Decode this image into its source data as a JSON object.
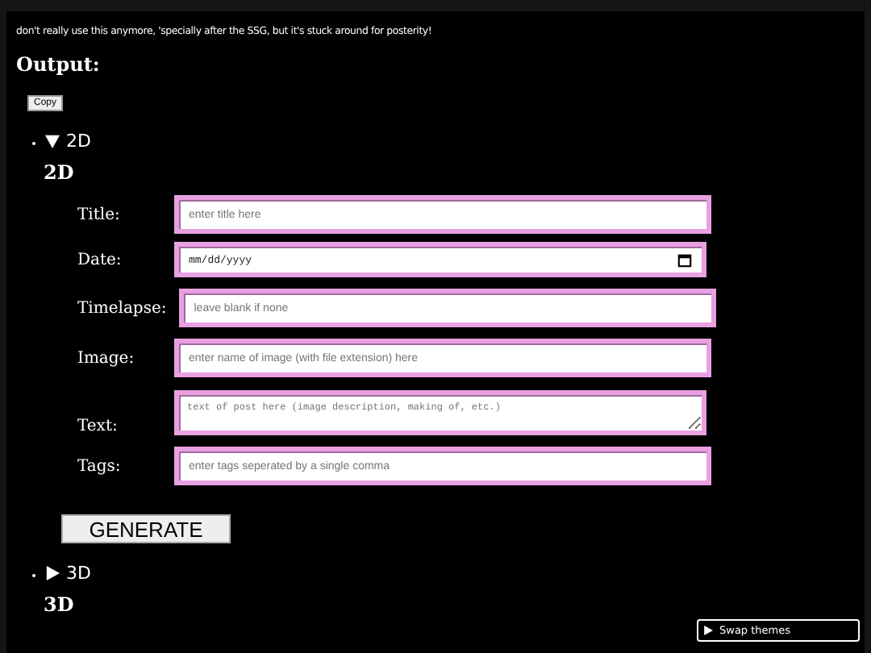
{
  "note": "don't really use this anymore, 'specially after the SSG, but it's stuck around for posterity!",
  "output_heading": "Output:",
  "copy_button": "Copy",
  "sections": [
    {
      "summary": "2D",
      "expanded": true,
      "heading": "2D",
      "fields": [
        {
          "label": "Title:",
          "kind": "text",
          "placeholder": "enter title here"
        },
        {
          "label": "Date:",
          "kind": "date",
          "placeholder": "mm/dd/yyyy"
        },
        {
          "label": "Timelapse:",
          "kind": "text",
          "placeholder": "leave blank if none"
        },
        {
          "label": "Image:",
          "kind": "text",
          "placeholder": "enter name of image (with file extension) here"
        },
        {
          "label": "Text:",
          "kind": "textarea",
          "placeholder": "text of post here (image description, making of, etc.)"
        },
        {
          "label": "Tags:",
          "kind": "text",
          "placeholder": "enter tags seperated by a single comma"
        }
      ],
      "button": "GENERATE"
    },
    {
      "summary": "3D",
      "expanded": false,
      "heading": "3D"
    }
  ],
  "theme_toggle": {
    "label": "Swap themes",
    "expanded": false
  }
}
